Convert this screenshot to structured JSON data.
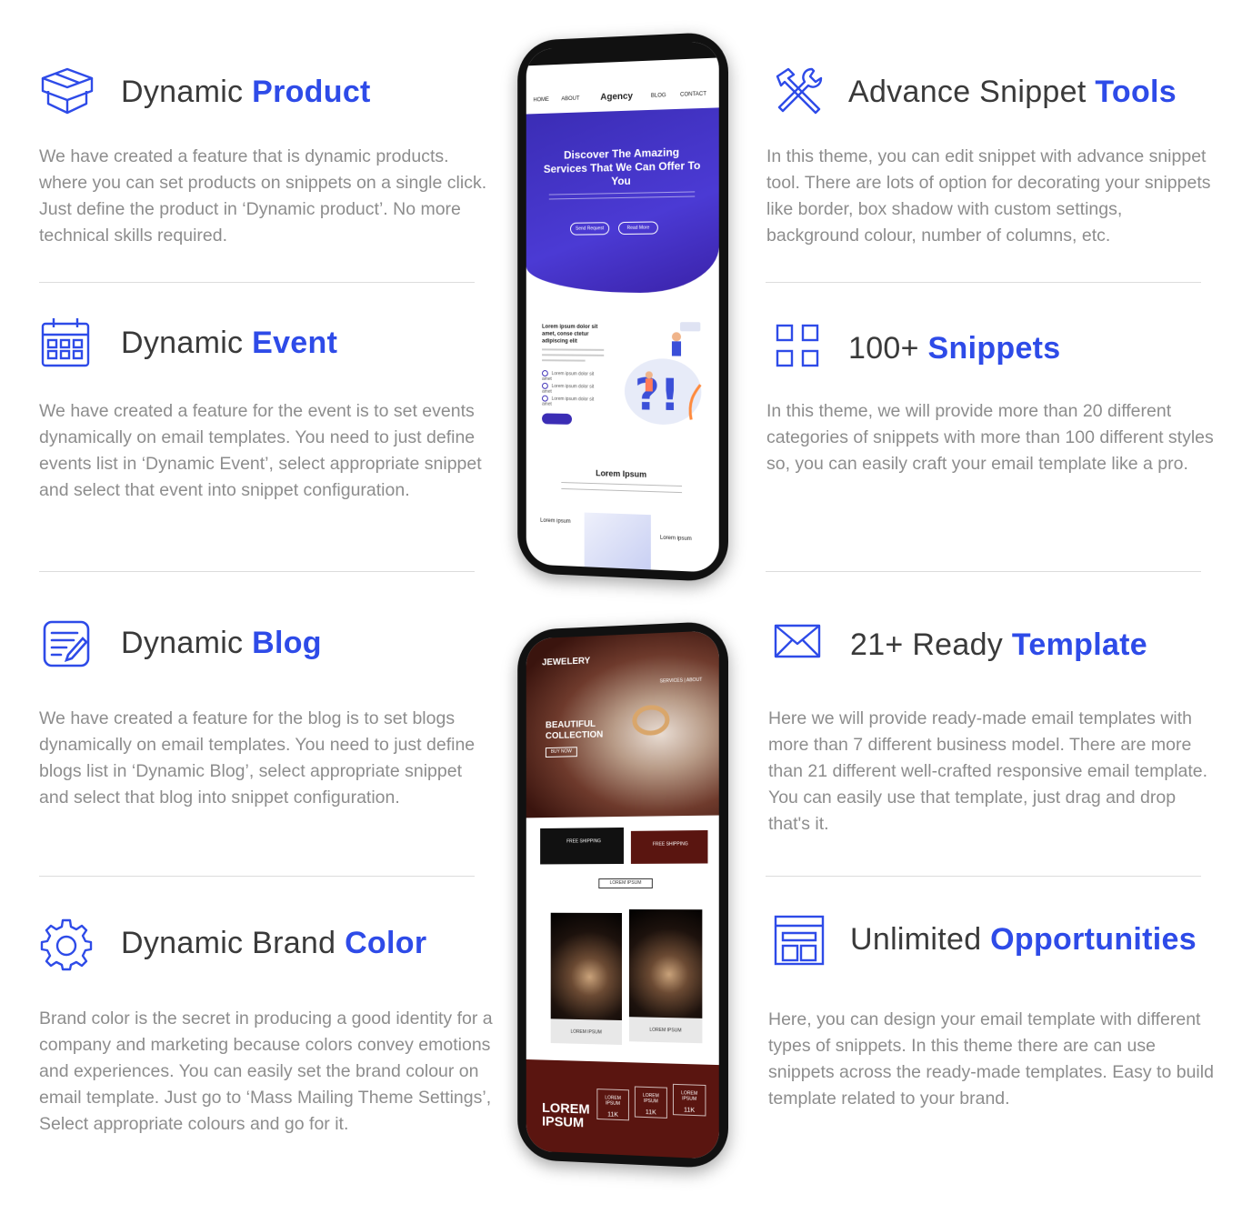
{
  "left": [
    {
      "title": "Dynamic ",
      "accent": "Product",
      "icon": "box-icon",
      "desc": "We have created a feature that is dynamic products. where you can set products on snippets on a single click. Just define the product in ‘Dynamic product’. No more technical skills required."
    },
    {
      "title": "Dynamic ",
      "accent": "Event",
      "icon": "calendar-icon",
      "desc": "We have created a feature for the event is to set events dynamically on email templates. You need to just define events list in ‘Dynamic Event’, select appropriate snippet and select that event into snippet configuration."
    },
    {
      "title": "Dynamic ",
      "accent": "Blog",
      "icon": "edit-document-icon",
      "desc": "We have created a feature for the blog is to set blogs dynamically on email templates. You need to just define blogs list in ‘Dynamic Blog’, select appropriate snippet and select that blog into snippet configuration."
    },
    {
      "title": "Dynamic Brand ",
      "accent": "Color",
      "icon": "gear-icon",
      "desc": "Brand color is the secret in producing a good identity for a company and marketing because colors convey emotions and experiences. You can easily set the brand colour on email template. Just go to ‘Mass Mailing Theme Settings’, Select appropriate colours and go for it."
    }
  ],
  "right": [
    {
      "title": "Advance Snippet ",
      "accent": "Tools",
      "icon": "tools-icon",
      "desc": "In this theme, you can edit snippet with advance snippet tool. There are lots of option for decorating your snippets like border, box shadow with custom settings, background colour, number of columns, etc."
    },
    {
      "title": "100+ ",
      "accent": "Snippets",
      "icon": "grid-icon",
      "desc": "In this theme, we will provide more than 20 different categories of snippets with more than 100 different styles so, you can easily craft your email template like a pro."
    },
    {
      "title": "21+ Ready ",
      "accent": "Template",
      "icon": "envelope-icon",
      "desc": "Here we will provide ready-made email templates with more than 7 different business model. There are more than 21 different well-crafted responsive email template. You can easily use that template, just drag and drop that's it."
    },
    {
      "title": "Unlimited ",
      "accent": "Opportunities",
      "icon": "layout-icon",
      "desc": "Here, you can design your email template with different types of snippets. In this theme there are can use snippets across the ready-made templates. Easy to build template related to your brand."
    }
  ],
  "phone1": {
    "nav": [
      "HOME",
      "ABOUT",
      "Agency",
      "BLOG",
      "CONTACT"
    ],
    "hero_title": "Discover The Amazing Services That We Can Offer To You",
    "btn1": "Send Request",
    "btn2": "Read More",
    "body_heading": "Lorem ipsum dolor sit amet, conse ctetur adipiscing elit",
    "checks": [
      "Lorem ipsum dolor sit amet",
      "Lorem ipsum dolor sit amet",
      "Lorem ipsum dolor sit amet"
    ],
    "read_more": "Read More",
    "lorem": "Lorem Ipsum",
    "foot_left": "Lorem ipsum",
    "foot_right": "Lorem ipsum"
  },
  "phone2": {
    "brand": "JEWELERY",
    "nav": "SERVICES | ABOUT",
    "collection": "BEAUTIFUL COLLECTION",
    "buy": "BUY NOW",
    "ship1": "FREE SHIPPING",
    "ship2": "FREE SHIPPING",
    "lorem_btn": "LOREM IPSUM",
    "prod1": "LOREM IPSUM",
    "prod2": "LOREM IPSUM",
    "big": "LOREM IPSUM",
    "stats": [
      {
        "label": "LOREM IPSUM",
        "value": "11K"
      },
      {
        "label": "LOREM IPSUM",
        "value": "11K"
      },
      {
        "label": "LOREM IPSUM",
        "value": "11K"
      }
    ]
  },
  "colors": {
    "accent": "#2e4be8",
    "text": "#3a3a3a",
    "desc": "#8d8d8d"
  }
}
